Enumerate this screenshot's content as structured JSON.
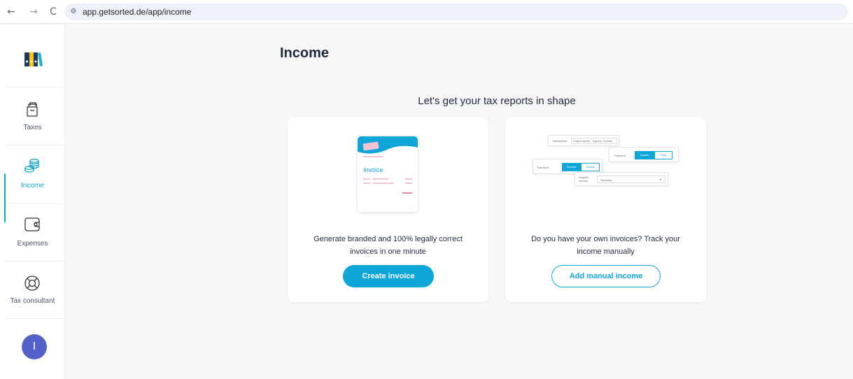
{
  "browser": {
    "url": "app.getsorted.de/app/income",
    "back_icon": "←",
    "forward_icon": "→",
    "reload_icon": "C",
    "site_icon": "⚙"
  },
  "sidebar": {
    "items": [
      {
        "label": "Taxes",
        "icon": "taxes-box-icon"
      },
      {
        "label": "Income",
        "icon": "coins-stack-icon",
        "active": true
      },
      {
        "label": "Expenses",
        "icon": "wallet-icon"
      },
      {
        "label": "Tax consultant",
        "icon": "lifebuoy-icon"
      }
    ],
    "avatar_initial": "I"
  },
  "main": {
    "title": "Income",
    "subtitle": "Let's get your tax reports in shape",
    "cards": [
      {
        "text": "Generate branded and 100% legally correct invoices in one minute",
        "button": "Create invoice",
        "illustration_title": "Invoice"
      },
      {
        "text": "Do you have your own invoices? Track your income manually",
        "button": "Add manual income",
        "illustration": {
          "description_label": "Description",
          "description_value": "Project Apollo - Agency Overlist",
          "payment_label": "Payment",
          "payment_on": "Unpaid",
          "payment_off": "Paid",
          "sold_label": "Sold Item",
          "sold_on": "Service",
          "sold_off": "Goods",
          "country_label": "Supplier country",
          "country_value": "Germany"
        }
      }
    ]
  },
  "colors": {
    "accent": "#0ea5d9",
    "avatar": "#5360c9",
    "text": "#1f2a3c"
  }
}
